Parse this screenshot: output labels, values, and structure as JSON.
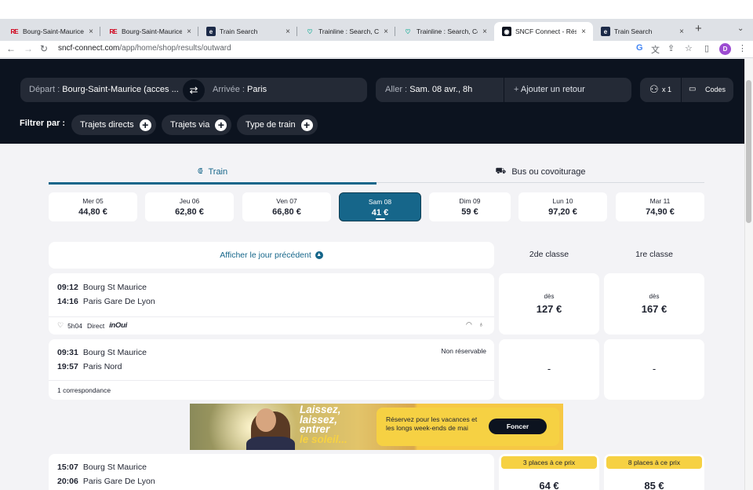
{
  "browser": {
    "tabs": [
      {
        "title": "Bourg-Saint-Maurice t",
        "favicon": "RE",
        "favicon_kind": "re"
      },
      {
        "title": "Bourg-Saint-Maurice e",
        "favicon": "RE",
        "favicon_kind": "re"
      },
      {
        "title": "Train Search",
        "favicon": "e",
        "favicon_kind": "train"
      },
      {
        "title": "Trainline : Search, Co",
        "favicon": "♡",
        "favicon_kind": "tl"
      },
      {
        "title": "Trainline : Search, Co",
        "favicon": "♡",
        "favicon_kind": "tl"
      },
      {
        "title": "SNCF Connect - Résu",
        "favicon": "◉",
        "favicon_kind": "sncf"
      },
      {
        "title": "Train Search",
        "favicon": "e",
        "favicon_kind": "train"
      }
    ],
    "active_tab_index": 5,
    "close_glyph": "×",
    "new_tab_glyph": "+",
    "tab_menu_glyph": "⌄",
    "back_glyph": "←",
    "forward_glyph": "→",
    "reload_glyph": "↻",
    "lock_glyph": "🔒",
    "url_host": "sncf-connect.com",
    "url_path": "/app/home/shop/results/outward",
    "profile_initial": "D"
  },
  "search": {
    "depart_label": "Départ :",
    "depart_value": "Bourg-Saint-Maurice (acces ...",
    "swap_glyph": "⇄",
    "arrivee_label": "Arrivée :",
    "arrivee_value": "Paris",
    "aller_label": "Aller :",
    "aller_value": "Sam. 08 avr., 8h",
    "retour_label": "Ajouter un retour",
    "retour_plus": "+",
    "pax_count": "x 1",
    "codes_label": "Codes"
  },
  "filters": {
    "label": "Filtrer par :",
    "chips": [
      "Trajets directs",
      "Trajets via",
      "Type de train"
    ],
    "plus_glyph": "+"
  },
  "modes": {
    "train": "Train",
    "bus": "Bus ou covoiturage"
  },
  "days": [
    {
      "day": "Mer 05",
      "price": "44,80 €"
    },
    {
      "day": "Jeu 06",
      "price": "62,80 €"
    },
    {
      "day": "Ven 07",
      "price": "66,80 €"
    },
    {
      "day": "Sam 08",
      "price": "41 €"
    },
    {
      "day": "Dim 09",
      "price": "59 €"
    },
    {
      "day": "Lun 10",
      "price": "97,20 €"
    },
    {
      "day": "Mar 11",
      "price": "74,90 €"
    }
  ],
  "selected_day_index": 3,
  "results": {
    "prev_day": "Afficher le jour précédent",
    "col_second": "2de classe",
    "col_first": "1re classe",
    "journeys": [
      {
        "dep_time": "09:12",
        "dep_station": "Bourg St Maurice",
        "arr_time": "14:16",
        "arr_station": "Paris Gare De Lyon",
        "duration": "5h04",
        "type": "Direct",
        "brand": "inOui",
        "second": {
          "from": "dès",
          "price": "127 €"
        },
        "first": {
          "from": "dès",
          "price": "167 €"
        }
      },
      {
        "dep_time": "09:31",
        "dep_station": "Bourg St Maurice",
        "arr_time": "19:57",
        "arr_station": "Paris Nord",
        "note": "Non réservable",
        "connections": "1 correspondance",
        "second": {
          "price": "-"
        },
        "first": {
          "price": "-"
        }
      },
      {
        "dep_time": "15:07",
        "dep_station": "Bourg St Maurice",
        "arr_time": "20:06",
        "arr_station": "Paris Gare De Lyon",
        "second": {
          "badge": "3 places à ce prix",
          "price": "64 €"
        },
        "first": {
          "badge": "8 places à ce prix",
          "price": "85 €"
        }
      }
    ]
  },
  "banner": {
    "line1": "Laissez,",
    "line2": "laissez,",
    "line3": "entrer",
    "line4": "le soleil...",
    "text": "Réservez pour les vacances et les longs week-ends de mai",
    "cta": "Foncer"
  },
  "colors": {
    "header_bg": "#0c131f",
    "accent": "#16668a",
    "badge": "#f6d143"
  }
}
